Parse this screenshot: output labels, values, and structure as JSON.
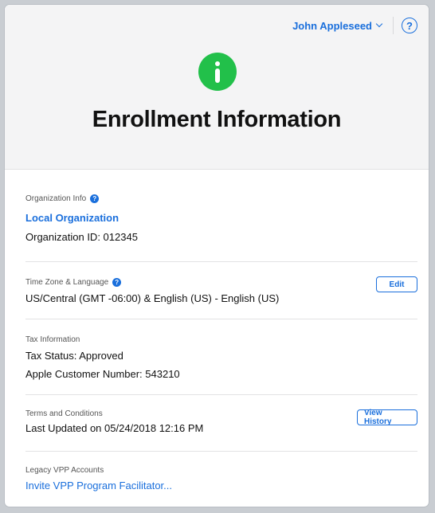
{
  "header": {
    "user_name": "John Appleseed",
    "help_glyph": "?",
    "info_icon": "info-icon",
    "title": "Enrollment Information"
  },
  "sections": {
    "organization": {
      "label": "Organization Info",
      "name": "Local Organization",
      "id_text": "Organization ID: 012345"
    },
    "timezone": {
      "label": "Time Zone & Language",
      "value": "US/Central (GMT -06:00) & English (US) - English (US)",
      "edit_label": "Edit"
    },
    "tax": {
      "label": "Tax Information",
      "status": "Tax Status: Approved",
      "customer_number": "Apple Customer Number: 543210"
    },
    "terms": {
      "label": "Terms and Conditions",
      "last_updated": "Last Updated on 05/24/2018 12:16 PM",
      "history_label": "View History"
    },
    "legacy": {
      "label": "Legacy VPP Accounts",
      "invite_link": "Invite VPP Program Facilitator..."
    }
  },
  "colors": {
    "accent": "#1a6fdc",
    "info_badge": "#22c04a",
    "header_bg": "#f4f4f5"
  }
}
